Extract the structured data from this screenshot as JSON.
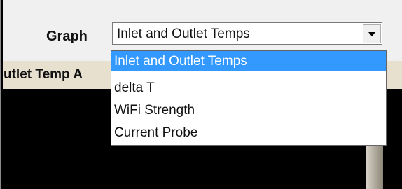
{
  "graph_control": {
    "label": "Graph",
    "selected_value": "Inlet and Outlet Temps",
    "arrow_icon": "chevron-down-icon",
    "options": [
      "Inlet and Outlet Temps",
      "delta T",
      "WiFi Strength",
      "Current Probe"
    ],
    "highlighted_option_index": 0
  },
  "table_header": {
    "text": "utlet Temp A"
  },
  "colors": {
    "panel_background": "#f0f0f0",
    "header_background": "#e8e0cf",
    "content_background": "#000000",
    "selection_highlight": "#3399ff"
  }
}
